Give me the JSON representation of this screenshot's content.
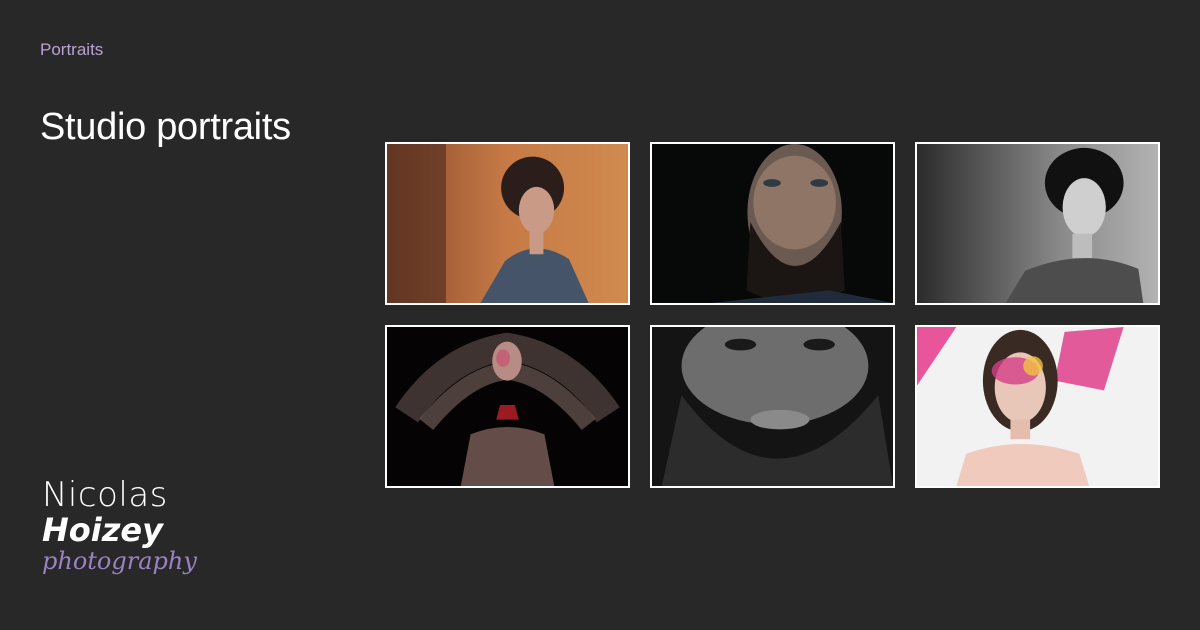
{
  "breadcrumb": {
    "label": "Portraits"
  },
  "page": {
    "title": "Studio portraits"
  },
  "gallery": {
    "images": [
      {
        "subject": "woman-curly-hair-orange-backdrop",
        "tone": "color"
      },
      {
        "subject": "bearded-man-dark",
        "tone": "color"
      },
      {
        "subject": "woman-curly-hair-bw",
        "tone": "monochrome"
      },
      {
        "subject": "woman-motion-blur-hands",
        "tone": "color"
      },
      {
        "subject": "bearded-man-closeup-bw",
        "tone": "monochrome"
      },
      {
        "subject": "woman-colorful-face-paint-pink",
        "tone": "color"
      }
    ]
  },
  "logo": {
    "line1": "Nicolas",
    "line2": "Hoizey",
    "line3": "photography"
  },
  "colors": {
    "background": "#282828",
    "accent": "#b9a3d3",
    "logo_accent": "#9b82c3",
    "thumb_border": "#ffffff"
  }
}
